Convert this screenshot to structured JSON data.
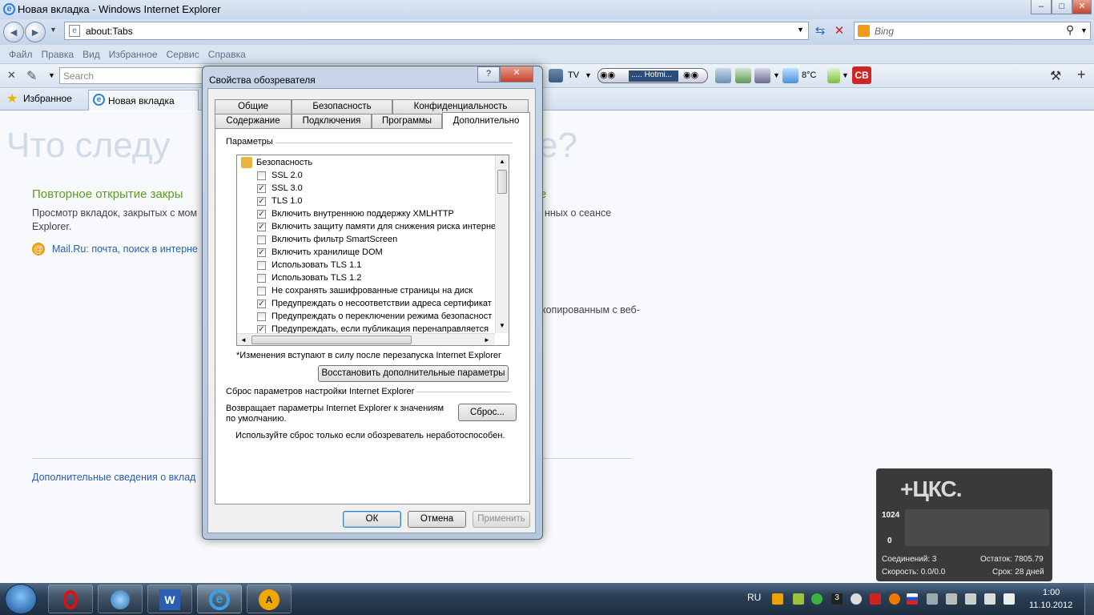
{
  "window": {
    "title": "Новая вкладка - Windows Internet Explorer",
    "min": "–",
    "max": "□",
    "close": "✕"
  },
  "address": {
    "value": "about:Tabs"
  },
  "search": {
    "placeholder": "Bing"
  },
  "menu": [
    "Файл",
    "Правка",
    "Вид",
    "Избранное",
    "Сервис",
    "Справка"
  ],
  "toolbar": {
    "search_placeholder": "Search",
    "tv": "TV",
    "hotmail": "..... Hotmi...",
    "temp": "8°C",
    "cb": "CB"
  },
  "favbar": {
    "favorites": "Избранное",
    "tab": "Новая вкладка"
  },
  "page": {
    "heading": "Что следу",
    "heading_end": "е?",
    "reopen": "Повторное открытие закры",
    "reopen_end": "е",
    "browse": "Просмотр вкладок, закрытых с мом",
    "browse_end": "нных о сеансе",
    "browse2": "Explorer.",
    "mailru": "Mail.Ru: почта, поиск в интерне",
    "copied": "копированным с веб-",
    "more": "Дополнительные сведения о вклад"
  },
  "dialog": {
    "title": "Свойства обозревателя",
    "help": "?",
    "close": "✕",
    "tabs_row1": [
      "Общие",
      "Безопасность",
      "Конфиденциальность"
    ],
    "tabs_row2": [
      "Содержание",
      "Подключения",
      "Программы",
      "Дополнительно"
    ],
    "params_label": "Параметры",
    "list_header": "Безопасность",
    "items": [
      {
        "label": "SSL 2.0",
        "checked": false
      },
      {
        "label": "SSL 3.0",
        "checked": true
      },
      {
        "label": "TLS 1.0",
        "checked": true
      },
      {
        "label": "Включить внутреннюю поддержку XMLHTTP",
        "checked": true
      },
      {
        "label": "Включить защиту памяти для снижения риска интерне",
        "checked": true
      },
      {
        "label": "Включить фильтр SmartScreen",
        "checked": false
      },
      {
        "label": "Включить хранилище DOM",
        "checked": true
      },
      {
        "label": "Использовать TLS 1.1",
        "checked": false
      },
      {
        "label": "Использовать TLS 1.2",
        "checked": false
      },
      {
        "label": "Не сохранять зашифрованные страницы на диск",
        "checked": false
      },
      {
        "label": "Предупреждать о несоответствии адреса сертификат",
        "checked": true
      },
      {
        "label": "Предупреждать о переключении режима безопасност",
        "checked": false
      },
      {
        "label": "Предупреждать, если публикация перенаправляется",
        "checked": true
      }
    ],
    "restart_note": "*Изменения вступают в силу после перезапуска Internet Explorer",
    "restore_btn": "Восстановить дополнительные параметры",
    "reset_group": "Сброс параметров настройки Internet Explorer",
    "reset_desc1": "Возвращает параметры Internet Explorer к значениям",
    "reset_desc2": "по умолчанию.",
    "reset_btn": "Сброс...",
    "reset_note": "Используйте сброс только если обозреватель неработоспособен.",
    "ok": "ОК",
    "cancel": "Отмена",
    "apply": "Применить"
  },
  "widget": {
    "logo": "+ЦКС.",
    "max": "1024",
    "min": "0",
    "connections": "Соединений: 3",
    "remaining": "Остаток: 7805.79",
    "speed": "Скорость: 0.0/0.0",
    "term": "Срок: 28 дней"
  },
  "taskbar": {
    "lang": "RU",
    "time": "1:00",
    "date": "11.10.2012"
  },
  "colors": {
    "accent_green": "#5a9e1f",
    "link": "#2a5db0",
    "dialog_frame": "#b4c7dd"
  }
}
